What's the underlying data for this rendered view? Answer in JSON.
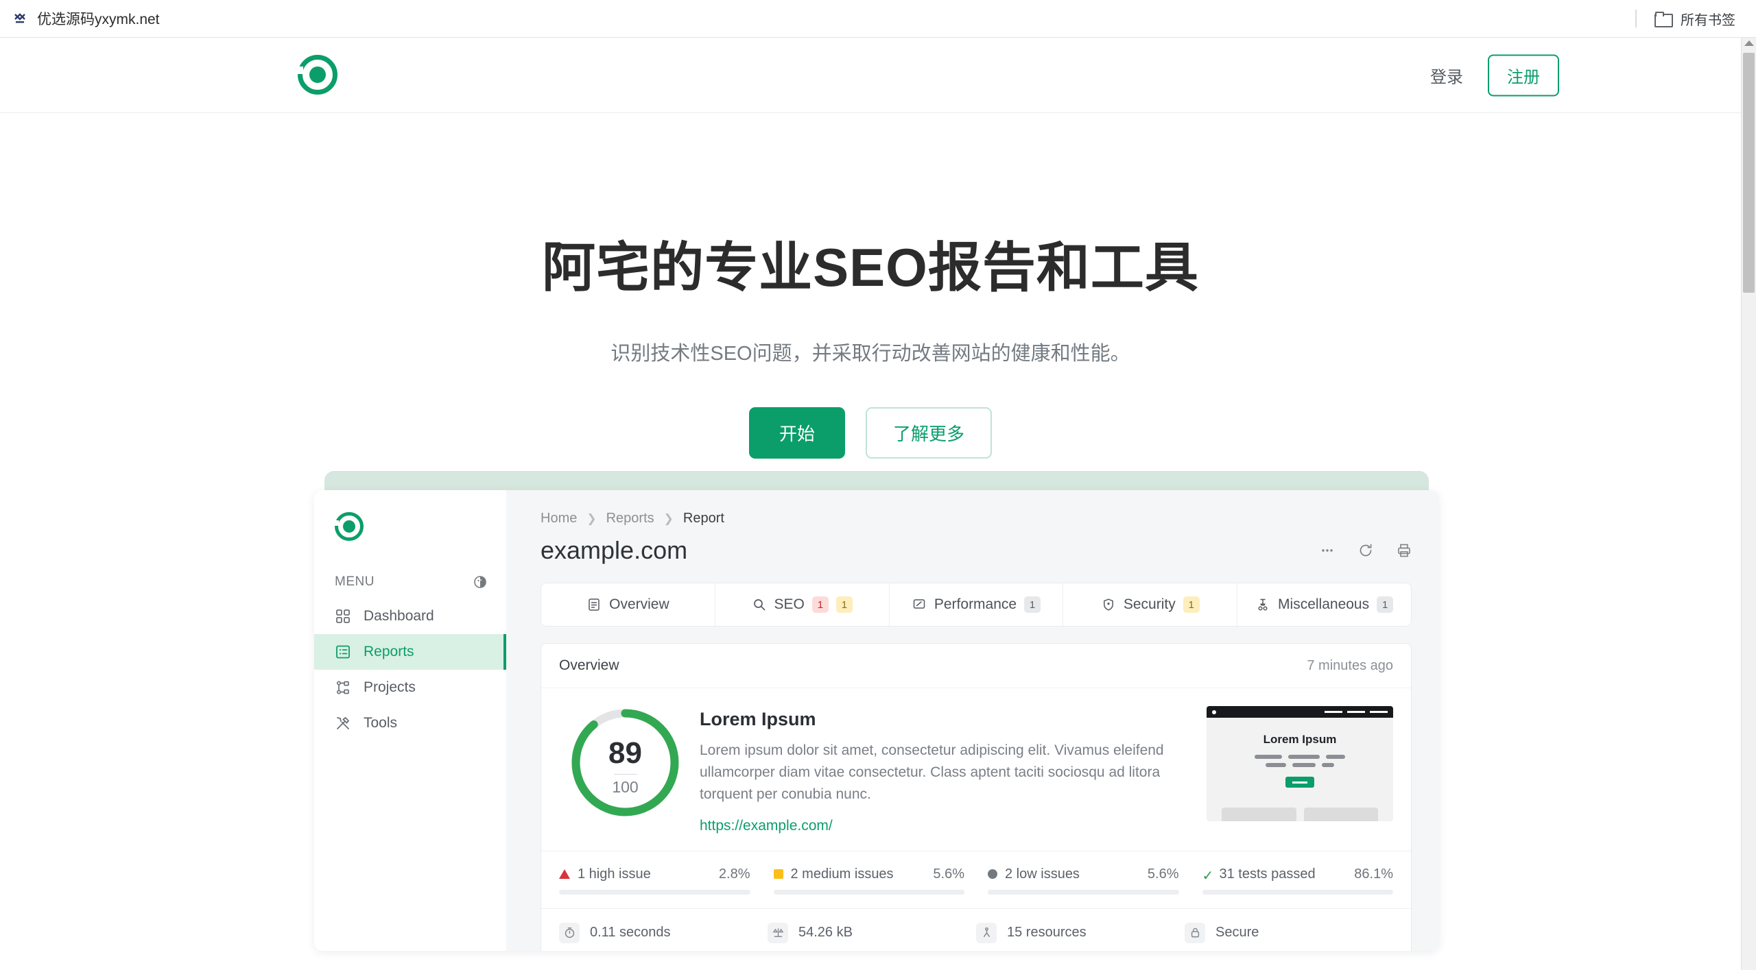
{
  "browser": {
    "favicon": "yx-logo-icon",
    "tab_label": "优选源码yxymk.net",
    "bookmarks_label": "所有书签",
    "folder_icon": "folder-icon"
  },
  "site_header": {
    "logo": "target-logo-icon",
    "login_label": "登录",
    "register_label": "注册"
  },
  "hero": {
    "title": "阿宅的专业SEO报告和工具",
    "subtitle": "识别技术性SEO问题，并采取行动改善网站的健康和性能。",
    "primary_button": "开始",
    "secondary_button": "了解更多"
  },
  "app": {
    "sidebar": {
      "logo": "target-logo-icon",
      "menu_label": "MENU",
      "toggle_icon": "contrast-icon",
      "items": [
        {
          "label": "Dashboard",
          "icon": "grid-icon",
          "active": false
        },
        {
          "label": "Reports",
          "icon": "list-card-icon",
          "active": true
        },
        {
          "label": "Projects",
          "icon": "sitemap-icon",
          "active": false
        },
        {
          "label": "Tools",
          "icon": "tools-icon",
          "active": false
        }
      ]
    },
    "breadcrumb": {
      "home": "Home",
      "sep": "❯",
      "reports": "Reports",
      "current": "Report"
    },
    "report": {
      "title": "example.com",
      "actions": [
        {
          "name": "more-icon",
          "glyph": "•••"
        },
        {
          "name": "refresh-icon",
          "glyph": "⟳"
        },
        {
          "name": "print-icon",
          "glyph": "⎙"
        }
      ]
    },
    "tabs": [
      {
        "label": "Overview",
        "icon": "clipboard-icon",
        "badges": []
      },
      {
        "label": "SEO",
        "icon": "search-icon",
        "badges": [
          {
            "value": "1",
            "tone": "red"
          },
          {
            "value": "1",
            "tone": "yellow"
          }
        ]
      },
      {
        "label": "Performance",
        "icon": "gauge-icon",
        "badges": [
          {
            "value": "1",
            "tone": "gray"
          }
        ]
      },
      {
        "label": "Security",
        "icon": "shield-icon",
        "badges": [
          {
            "value": "1",
            "tone": "yellow"
          }
        ]
      },
      {
        "label": "Miscellaneous",
        "icon": "flask-icon",
        "badges": [
          {
            "value": "1",
            "tone": "gray"
          }
        ]
      }
    ],
    "overview": {
      "heading": "Overview",
      "timestamp": "7 minutes ago",
      "score": "89",
      "score_max": "100",
      "score_percent": 89,
      "content_heading": "Lorem Ipsum",
      "content_paragraph": "Lorem ipsum dolor sit amet, consectetur adipiscing elit. Vivamus eleifend ullamcorper diam vitae consectetur. Class aptent taciti sociosqu ad litora torquent per conubia nunc.",
      "url": "https://example.com/",
      "thumbnail": {
        "title": "Lorem Ipsum",
        "accent_color": "#0b9e6a"
      },
      "stats": [
        {
          "label": "1 high issue",
          "percent": "2.8%",
          "fill": 2.8,
          "marker": "triangle",
          "color": "#d8343c"
        },
        {
          "label": "2 medium issues",
          "percent": "5.6%",
          "fill": 5.6,
          "marker": "square",
          "color": "#fbbf18"
        },
        {
          "label": "2 low issues",
          "percent": "5.6%",
          "fill": 5.6,
          "marker": "circle",
          "color": "#74797f"
        },
        {
          "label": "31 tests passed",
          "percent": "86.1%",
          "fill": 86.1,
          "marker": "check",
          "color": "#2e9e4f"
        }
      ],
      "metrics": [
        {
          "label": "0.11 seconds",
          "icon": "timer-icon"
        },
        {
          "label": "54.26 kB",
          "icon": "scale-icon"
        },
        {
          "label": "15 resources",
          "icon": "resources-icon"
        },
        {
          "label": "Secure",
          "icon": "lock-icon"
        }
      ]
    }
  },
  "colors": {
    "brand_green": "#0b9e6a",
    "band_green": "#d5e7de",
    "active_bg": "#d9f0e5"
  }
}
